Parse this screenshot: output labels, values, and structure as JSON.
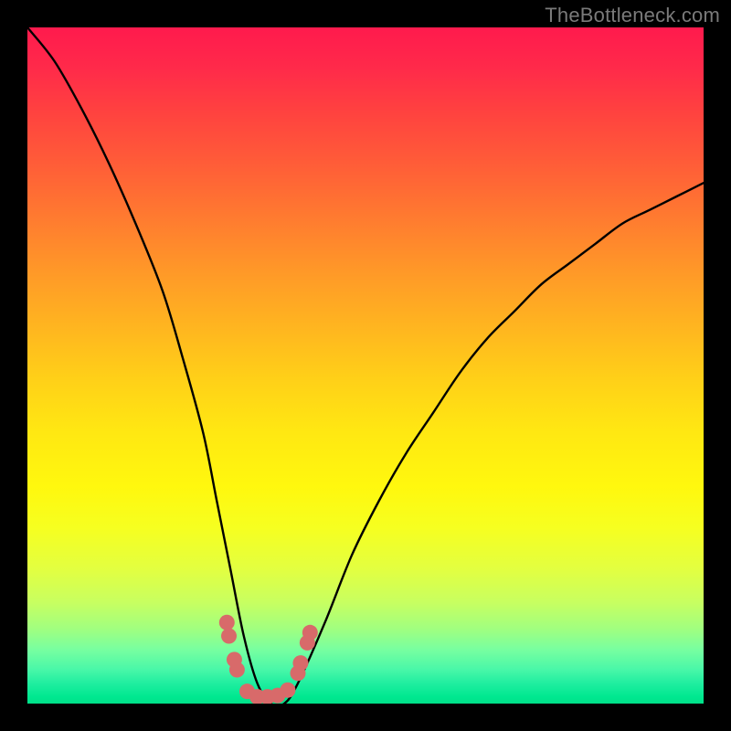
{
  "watermark": "TheBottleneck.com",
  "chart_data": {
    "type": "line",
    "title": "",
    "xlabel": "",
    "ylabel": "",
    "xlim": [
      0,
      100
    ],
    "ylim": [
      0,
      100
    ],
    "grid": false,
    "series": [
      {
        "name": "bottleneck-curve",
        "x": [
          0,
          4,
          8,
          12,
          16,
          20,
          23,
          26,
          28,
          30,
          32,
          34,
          36,
          38,
          40,
          44,
          48,
          52,
          56,
          60,
          64,
          68,
          72,
          76,
          80,
          84,
          88,
          92,
          96,
          100
        ],
        "values": [
          100,
          95,
          88,
          80,
          71,
          61,
          51,
          40,
          30,
          20,
          10,
          3,
          0,
          0,
          3,
          12,
          22,
          30,
          37,
          43,
          49,
          54,
          58,
          62,
          65,
          68,
          71,
          73,
          75,
          77
        ]
      }
    ],
    "markers": {
      "name": "highlight-dots",
      "color": "#d86a6a",
      "points": [
        {
          "x": 29.5,
          "y": 12
        },
        {
          "x": 29.8,
          "y": 10
        },
        {
          "x": 30.6,
          "y": 6.5
        },
        {
          "x": 31.0,
          "y": 5
        },
        {
          "x": 32.5,
          "y": 1.8
        },
        {
          "x": 34.0,
          "y": 1.0
        },
        {
          "x": 35.5,
          "y": 1.0
        },
        {
          "x": 37.0,
          "y": 1.2
        },
        {
          "x": 38.5,
          "y": 2.0
        },
        {
          "x": 40.0,
          "y": 4.5
        },
        {
          "x": 40.4,
          "y": 6
        },
        {
          "x": 41.4,
          "y": 9
        },
        {
          "x": 41.8,
          "y": 10.5
        }
      ]
    },
    "gradient_stops": [
      {
        "pos": 0,
        "color": "#ff1a4d"
      },
      {
        "pos": 50,
        "color": "#ffd018"
      },
      {
        "pos": 75,
        "color": "#f0ff30"
      },
      {
        "pos": 100,
        "color": "#00e088"
      }
    ]
  }
}
